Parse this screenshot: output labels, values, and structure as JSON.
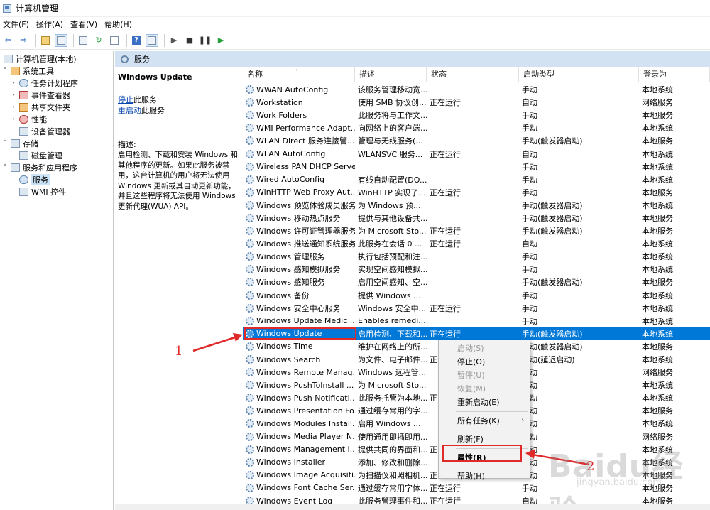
{
  "window": {
    "title": "计算机管理"
  },
  "menu": [
    "文件(F)",
    "操作(A)",
    "查看(V)",
    "帮助(H)"
  ],
  "toolbar": {
    "icons": [
      "back-arrow-icon",
      "forward-arrow-icon",
      "up-folder-icon",
      "show-hide-tree-icon",
      "properties-icon",
      "refresh-icon",
      "export-icon",
      "help-icon",
      "show-hide-action-icon",
      "play-icon",
      "stop-icon",
      "pause-icon",
      "restart-icon"
    ]
  },
  "tree": {
    "root": "计算机管理(本地)",
    "system_tools": "系统工具",
    "task_scheduler": "任务计划程序",
    "event_viewer": "事件查看器",
    "shared_folders": "共享文件夹",
    "performance": "性能",
    "device_manager": "设备管理器",
    "storage": "存储",
    "disk_management": "磁盘管理",
    "services_apps": "服务和应用程序",
    "services": "服务",
    "wmi": "WMI 控件"
  },
  "panel": {
    "header": "服务",
    "selected_name": "Windows Update",
    "stop_link": "停止",
    "stop_suffix": "此服务",
    "restart_link": "重启动",
    "restart_suffix": "此服务",
    "desc_label": "描述:",
    "desc_lines": [
      "启用检测、下载和安装 Windows 和",
      "其他程序的更新。如果此服务被禁",
      "用，这台计算机的用户将无法使用",
      "Windows 更新或其自动更新功能，",
      "并且这些程序将无法使用 Windows",
      "更新代理(WUA) API。"
    ]
  },
  "columns": [
    "名称",
    "描述",
    "状态",
    "启动类型",
    "登录为"
  ],
  "services": [
    [
      "WWAN AutoConfig",
      "该服务管理移动宽...",
      "",
      "手动",
      "本地系统"
    ],
    [
      "Workstation",
      "使用 SMB 协议创...",
      "正在运行",
      "自动",
      "网络服务"
    ],
    [
      "Work Folders",
      "此服务将与工作文...",
      "",
      "手动",
      "本地服务"
    ],
    [
      "WMI Performance Adapt...",
      "向网络上的客户端...",
      "",
      "手动",
      "本地系统"
    ],
    [
      "WLAN Direct 服务连接管...",
      "管理与无线服务(...",
      "",
      "手动(触发器启动)",
      "本地服务"
    ],
    [
      "WLAN AutoConfig",
      "WLANSVC 服务...",
      "正在运行",
      "自动",
      "本地系统"
    ],
    [
      "Wireless PAN DHCP Server",
      "",
      "",
      "手动",
      "本地系统"
    ],
    [
      "Wired AutoConfig",
      "有线自动配置(DO...",
      "",
      "手动",
      "本地系统"
    ],
    [
      "WinHTTP Web Proxy Aut...",
      "WinHTTP 实现了...",
      "正在运行",
      "手动",
      "本地服务"
    ],
    [
      "Windows 预览体验成员服务",
      "为 Windows 预...",
      "",
      "手动(触发器启动)",
      "本地系统"
    ],
    [
      "Windows 移动热点服务",
      "提供与其他设备共...",
      "",
      "手动(触发器启动)",
      "本地服务"
    ],
    [
      "Windows 许可证管理器服务",
      "为 Microsoft Sto...",
      "正在运行",
      "手动(触发器启动)",
      "本地服务"
    ],
    [
      "Windows 推送通知系统服务",
      "此服务在会话 0 ...",
      "正在运行",
      "自动",
      "本地系统"
    ],
    [
      "Windows 管理服务",
      "执行包括预配和注...",
      "",
      "手动",
      "本地系统"
    ],
    [
      "Windows 感知模拟服务",
      "实现空间感知模拟...",
      "",
      "手动",
      "本地系统"
    ],
    [
      "Windows 感知服务",
      "启用空间感知、空...",
      "",
      "手动(触发器启动)",
      "本地服务"
    ],
    [
      "Windows 备份",
      "提供 Windows ...",
      "",
      "手动",
      "本地系统"
    ],
    [
      "Windows 安全中心服务",
      "Windows 安全中...",
      "正在运行",
      "手动",
      "本地系统"
    ],
    [
      "Windows Update Medic ...",
      "Enables remedi...",
      "",
      "手动",
      "本地系统"
    ],
    [
      "Windows Update",
      "启用检测、下载和...",
      "正在运行",
      "手动(触发器启动)",
      "本地系统"
    ],
    [
      "Windows Time",
      "维护在网络上的所...",
      "",
      "手动(触发器启动)",
      "本地服务"
    ],
    [
      "Windows Search",
      "为文件、电子邮件...",
      "正",
      "自动(延迟启动)",
      "本地系统"
    ],
    [
      "Windows Remote Manag...",
      "Windows 远程管...",
      "",
      "手动",
      "网络服务"
    ],
    [
      "Windows PushToInstall ...",
      "为 Microsoft Sto...",
      "",
      "手动",
      "本地系统"
    ],
    [
      "Windows Push Notificati...",
      "此服务托管为本地...",
      "正",
      "自动",
      "本地系统"
    ],
    [
      "Windows Presentation Fo...",
      "通过缓存常用的字...",
      "",
      "手动",
      "本地服务"
    ],
    [
      "Windows Modules Install...",
      "启用 Windows ...",
      "",
      "手动",
      "本地系统"
    ],
    [
      "Windows Media Player N...",
      "使用通用即插即用...",
      "",
      "手动",
      "网络服务"
    ],
    [
      "Windows Management I...",
      "提供共同的界面和...",
      "正",
      "自动",
      "本地系统"
    ],
    [
      "Windows Installer",
      "添加、修改和删除...",
      "",
      "手动",
      "本地系统"
    ],
    [
      "Windows Image Acquisiti...",
      "为扫描仪和照相机...",
      "正",
      "手动",
      "本地服务"
    ],
    [
      "Windows Font Cache Ser...",
      "通过缓存常用字体...",
      "正在运行",
      "手动",
      "本地服务"
    ],
    [
      "Windows Event Log",
      "此服务管理事件和...",
      "正在运行",
      "自动",
      "本地服务"
    ]
  ],
  "selected_service_index": 19,
  "context_menu": {
    "start": "启动(S)",
    "stop": "停止(O)",
    "pause": "暂停(U)",
    "resume": "恢复(M)",
    "restart": "重新启动(E)",
    "all_tasks": "所有任务(K)",
    "refresh": "刷新(F)",
    "properties": "属性(R)",
    "help": "帮助(H)"
  },
  "annotations": {
    "label_1": "1",
    "label_2": "2"
  },
  "watermark": {
    "main": "Baidu经验",
    "sub": "jingyan.baidu.com"
  },
  "colors": {
    "selection": "#0078d7",
    "annotation_red": "#e02a2a",
    "header_bg": "#d3e2f3"
  }
}
